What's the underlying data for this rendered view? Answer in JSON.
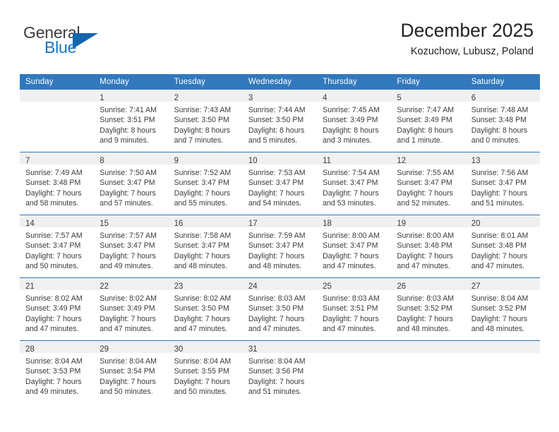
{
  "brand": {
    "name_top": "General",
    "name_bottom": "Blue",
    "triangle_color": "#1266ae",
    "blue_color": "#1673c4"
  },
  "header": {
    "title": "December 2025",
    "subtitle": "Kozuchow, Lubusz, Poland"
  },
  "theme": {
    "header_bg": "#3178bd",
    "daynum_bg": "#f0f0f0",
    "text": "#3b3b3b"
  },
  "weekday_headers": [
    "Sunday",
    "Monday",
    "Tuesday",
    "Wednesday",
    "Thursday",
    "Friday",
    "Saturday"
  ],
  "weeks": [
    [
      {
        "day": "",
        "sunrise": "",
        "sunset": "",
        "daylight_1": "",
        "daylight_2": ""
      },
      {
        "day": "1",
        "sunrise": "Sunrise: 7:41 AM",
        "sunset": "Sunset: 3:51 PM",
        "daylight_1": "Daylight: 8 hours",
        "daylight_2": "and 9 minutes."
      },
      {
        "day": "2",
        "sunrise": "Sunrise: 7:43 AM",
        "sunset": "Sunset: 3:50 PM",
        "daylight_1": "Daylight: 8 hours",
        "daylight_2": "and 7 minutes."
      },
      {
        "day": "3",
        "sunrise": "Sunrise: 7:44 AM",
        "sunset": "Sunset: 3:50 PM",
        "daylight_1": "Daylight: 8 hours",
        "daylight_2": "and 5 minutes."
      },
      {
        "day": "4",
        "sunrise": "Sunrise: 7:45 AM",
        "sunset": "Sunset: 3:49 PM",
        "daylight_1": "Daylight: 8 hours",
        "daylight_2": "and 3 minutes."
      },
      {
        "day": "5",
        "sunrise": "Sunrise: 7:47 AM",
        "sunset": "Sunset: 3:49 PM",
        "daylight_1": "Daylight: 8 hours",
        "daylight_2": "and 1 minute."
      },
      {
        "day": "6",
        "sunrise": "Sunrise: 7:48 AM",
        "sunset": "Sunset: 3:48 PM",
        "daylight_1": "Daylight: 8 hours",
        "daylight_2": "and 0 minutes."
      }
    ],
    [
      {
        "day": "7",
        "sunrise": "Sunrise: 7:49 AM",
        "sunset": "Sunset: 3:48 PM",
        "daylight_1": "Daylight: 7 hours",
        "daylight_2": "and 58 minutes."
      },
      {
        "day": "8",
        "sunrise": "Sunrise: 7:50 AM",
        "sunset": "Sunset: 3:47 PM",
        "daylight_1": "Daylight: 7 hours",
        "daylight_2": "and 57 minutes."
      },
      {
        "day": "9",
        "sunrise": "Sunrise: 7:52 AM",
        "sunset": "Sunset: 3:47 PM",
        "daylight_1": "Daylight: 7 hours",
        "daylight_2": "and 55 minutes."
      },
      {
        "day": "10",
        "sunrise": "Sunrise: 7:53 AM",
        "sunset": "Sunset: 3:47 PM",
        "daylight_1": "Daylight: 7 hours",
        "daylight_2": "and 54 minutes."
      },
      {
        "day": "11",
        "sunrise": "Sunrise: 7:54 AM",
        "sunset": "Sunset: 3:47 PM",
        "daylight_1": "Daylight: 7 hours",
        "daylight_2": "and 53 minutes."
      },
      {
        "day": "12",
        "sunrise": "Sunrise: 7:55 AM",
        "sunset": "Sunset: 3:47 PM",
        "daylight_1": "Daylight: 7 hours",
        "daylight_2": "and 52 minutes."
      },
      {
        "day": "13",
        "sunrise": "Sunrise: 7:56 AM",
        "sunset": "Sunset: 3:47 PM",
        "daylight_1": "Daylight: 7 hours",
        "daylight_2": "and 51 minutes."
      }
    ],
    [
      {
        "day": "14",
        "sunrise": "Sunrise: 7:57 AM",
        "sunset": "Sunset: 3:47 PM",
        "daylight_1": "Daylight: 7 hours",
        "daylight_2": "and 50 minutes."
      },
      {
        "day": "15",
        "sunrise": "Sunrise: 7:57 AM",
        "sunset": "Sunset: 3:47 PM",
        "daylight_1": "Daylight: 7 hours",
        "daylight_2": "and 49 minutes."
      },
      {
        "day": "16",
        "sunrise": "Sunrise: 7:58 AM",
        "sunset": "Sunset: 3:47 PM",
        "daylight_1": "Daylight: 7 hours",
        "daylight_2": "and 48 minutes."
      },
      {
        "day": "17",
        "sunrise": "Sunrise: 7:59 AM",
        "sunset": "Sunset: 3:47 PM",
        "daylight_1": "Daylight: 7 hours",
        "daylight_2": "and 48 minutes."
      },
      {
        "day": "18",
        "sunrise": "Sunrise: 8:00 AM",
        "sunset": "Sunset: 3:47 PM",
        "daylight_1": "Daylight: 7 hours",
        "daylight_2": "and 47 minutes."
      },
      {
        "day": "19",
        "sunrise": "Sunrise: 8:00 AM",
        "sunset": "Sunset: 3:48 PM",
        "daylight_1": "Daylight: 7 hours",
        "daylight_2": "and 47 minutes."
      },
      {
        "day": "20",
        "sunrise": "Sunrise: 8:01 AM",
        "sunset": "Sunset: 3:48 PM",
        "daylight_1": "Daylight: 7 hours",
        "daylight_2": "and 47 minutes."
      }
    ],
    [
      {
        "day": "21",
        "sunrise": "Sunrise: 8:02 AM",
        "sunset": "Sunset: 3:49 PM",
        "daylight_1": "Daylight: 7 hours",
        "daylight_2": "and 47 minutes."
      },
      {
        "day": "22",
        "sunrise": "Sunrise: 8:02 AM",
        "sunset": "Sunset: 3:49 PM",
        "daylight_1": "Daylight: 7 hours",
        "daylight_2": "and 47 minutes."
      },
      {
        "day": "23",
        "sunrise": "Sunrise: 8:02 AM",
        "sunset": "Sunset: 3:50 PM",
        "daylight_1": "Daylight: 7 hours",
        "daylight_2": "and 47 minutes."
      },
      {
        "day": "24",
        "sunrise": "Sunrise: 8:03 AM",
        "sunset": "Sunset: 3:50 PM",
        "daylight_1": "Daylight: 7 hours",
        "daylight_2": "and 47 minutes."
      },
      {
        "day": "25",
        "sunrise": "Sunrise: 8:03 AM",
        "sunset": "Sunset: 3:51 PM",
        "daylight_1": "Daylight: 7 hours",
        "daylight_2": "and 47 minutes."
      },
      {
        "day": "26",
        "sunrise": "Sunrise: 8:03 AM",
        "sunset": "Sunset: 3:52 PM",
        "daylight_1": "Daylight: 7 hours",
        "daylight_2": "and 48 minutes."
      },
      {
        "day": "27",
        "sunrise": "Sunrise: 8:04 AM",
        "sunset": "Sunset: 3:52 PM",
        "daylight_1": "Daylight: 7 hours",
        "daylight_2": "and 48 minutes."
      }
    ],
    [
      {
        "day": "28",
        "sunrise": "Sunrise: 8:04 AM",
        "sunset": "Sunset: 3:53 PM",
        "daylight_1": "Daylight: 7 hours",
        "daylight_2": "and 49 minutes."
      },
      {
        "day": "29",
        "sunrise": "Sunrise: 8:04 AM",
        "sunset": "Sunset: 3:54 PM",
        "daylight_1": "Daylight: 7 hours",
        "daylight_2": "and 50 minutes."
      },
      {
        "day": "30",
        "sunrise": "Sunrise: 8:04 AM",
        "sunset": "Sunset: 3:55 PM",
        "daylight_1": "Daylight: 7 hours",
        "daylight_2": "and 50 minutes."
      },
      {
        "day": "31",
        "sunrise": "Sunrise: 8:04 AM",
        "sunset": "Sunset: 3:56 PM",
        "daylight_1": "Daylight: 7 hours",
        "daylight_2": "and 51 minutes."
      },
      {
        "day": "",
        "sunrise": "",
        "sunset": "",
        "daylight_1": "",
        "daylight_2": ""
      },
      {
        "day": "",
        "sunrise": "",
        "sunset": "",
        "daylight_1": "",
        "daylight_2": ""
      },
      {
        "day": "",
        "sunrise": "",
        "sunset": "",
        "daylight_1": "",
        "daylight_2": ""
      }
    ]
  ]
}
